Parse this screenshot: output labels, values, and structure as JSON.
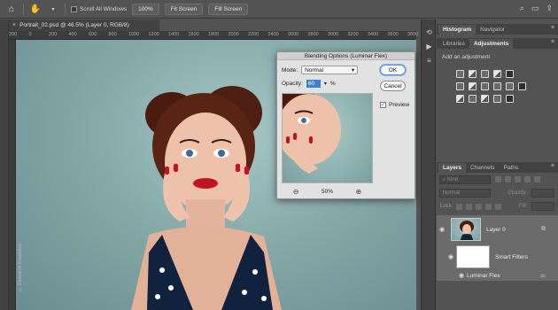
{
  "optionsbar": {
    "scroll_all_label": "Scroll All Windows",
    "zoom_btn": "100%",
    "fit_screen_btn": "Fit Screen",
    "fill_screen_btn": "Fill Screen"
  },
  "document": {
    "tab_title": "Portrait_02.psd @ 46.5% (Layer 0, RGB/8)"
  },
  "ruler": {
    "ticks": [
      "200",
      "0",
      "200",
      "400",
      "600",
      "800",
      "1000",
      "1200",
      "1400",
      "1600",
      "1800",
      "2000",
      "2200",
      "2400",
      "2600",
      "2800",
      "3000",
      "3200",
      "3400",
      "3600",
      "3800"
    ]
  },
  "canvas": {
    "watermark": "© Oleksandr Kovalchuk"
  },
  "dialog": {
    "title": "Blending Options (Luminar Flex)",
    "mode_label": "Mode:",
    "mode_value": "Normal",
    "opacity_label": "Opacity:",
    "opacity_value": "60",
    "opacity_unit": "%",
    "ok_label": "OK",
    "cancel_label": "Cancel",
    "preview_label": "Preview",
    "zoom_value": "50%"
  },
  "panels": {
    "top_tabs": [
      "Histogram",
      "Navigator"
    ],
    "adj_tabs": [
      "Libraries",
      "Adjustments"
    ],
    "add_adjustment": "Add an adjustment",
    "layer_tabs": [
      "Layers",
      "Channels",
      "Paths"
    ],
    "kind_placeholder": "Kind",
    "blend_mode": "Normal",
    "opacity_label": "Opacity:",
    "lock_label": "Lock:",
    "fill_label": "Fill:",
    "layers": [
      {
        "name": "Layer 0"
      },
      {
        "name": "Smart Filters"
      },
      {
        "name": "Luminar Flex"
      }
    ]
  },
  "colors": {
    "accent": "#3f7fd6",
    "canvas_bg": "#86a9aa",
    "ui_dark": "#535353"
  }
}
